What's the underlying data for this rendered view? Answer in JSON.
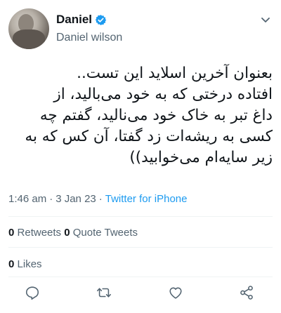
{
  "user": {
    "name": "Daniel",
    "handle": "Daniel wilson"
  },
  "tweet": {
    "text": "بعنوان آخرین اسلاید این تست..\nافتاده درختی که به خود می‌بالید، از\nداغ تبر به خاک خود می‌نالید، گفتم چه\nکسی به ریشه‌ات زد گفتا، آن کس که به\nزیر سایه‌ام می‌خوابید))",
    "time": "1:46 am",
    "separator1": "·",
    "date": "3 Jan 23",
    "separator2": "·",
    "source": "Twitter for iPhone"
  },
  "stats": {
    "retweets_count": "0",
    "retweets_label": "Retweets",
    "quotes_count": "0",
    "quotes_label": "Quote Tweets",
    "likes_count": "0",
    "likes_label": "Likes"
  },
  "icons": {
    "verified": "verified-badge-icon",
    "more": "chevron-down-icon",
    "reply": "reply-icon",
    "retweet": "retweet-icon",
    "like": "like-icon",
    "share": "share-icon"
  },
  "colors": {
    "accent": "#1d9bf0",
    "secondary_text": "#536471",
    "primary_text": "#0f1419"
  }
}
